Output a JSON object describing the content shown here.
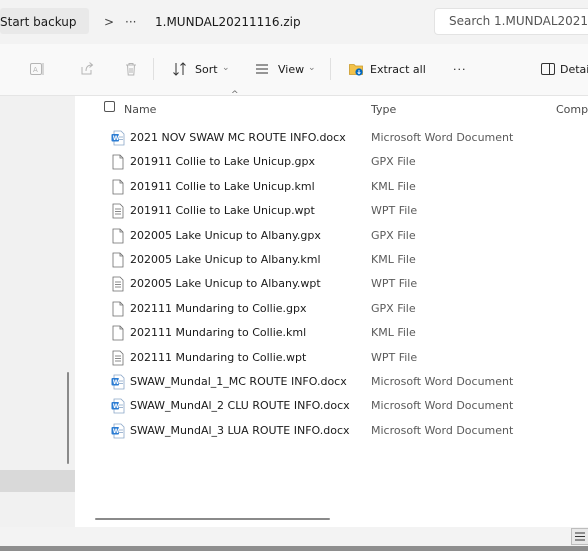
{
  "address_bar": {
    "breadcrumb_start": "Start backup",
    "separator": ">",
    "overflow": "···",
    "current_folder": "1.MUNDAL20211116.zip",
    "search_placeholder": "Search 1.MUNDAL20211"
  },
  "command_bar": {
    "sort_label": "Sort",
    "view_label": "View",
    "extract_all_label": "Extract all",
    "more_label": "···",
    "details_label": "Detai"
  },
  "columns": {
    "name": "Name",
    "type": "Type",
    "compressed": "Comp"
  },
  "files": [
    {
      "name": "2021 NOV SWAW MC ROUTE INFO.docx",
      "type": "Microsoft Word Document",
      "icon": "word-doc-icon"
    },
    {
      "name": "201911 Collie to Lake Unicup.gpx",
      "type": "GPX File",
      "icon": "file-icon"
    },
    {
      "name": "201911 Collie to Lake Unicup.kml",
      "type": "KML File",
      "icon": "file-icon"
    },
    {
      "name": "201911 Collie to Lake Unicup.wpt",
      "type": "WPT File",
      "icon": "text-file-icon"
    },
    {
      "name": "202005 Lake Unicup to Albany.gpx",
      "type": "GPX File",
      "icon": "file-icon"
    },
    {
      "name": "202005 Lake Unicup to Albany.kml",
      "type": "KML File",
      "icon": "file-icon"
    },
    {
      "name": "202005 Lake Unicup to Albany.wpt",
      "type": "WPT File",
      "icon": "text-file-icon"
    },
    {
      "name": "202111 Mundaring to Collie.gpx",
      "type": "GPX File",
      "icon": "file-icon"
    },
    {
      "name": "202111 Mundaring to Collie.kml",
      "type": "KML File",
      "icon": "file-icon"
    },
    {
      "name": "202111 Mundaring to Collie.wpt",
      "type": "WPT File",
      "icon": "text-file-icon"
    },
    {
      "name": "SWAW_Mundal_1_MC ROUTE INFO.docx",
      "type": "Microsoft Word Document",
      "icon": "word-doc-icon"
    },
    {
      "name": "SWAW_MundAl_2 CLU ROUTE INFO.docx",
      "type": "Microsoft Word Document",
      "icon": "word-doc-icon"
    },
    {
      "name": "SWAW_MundAl_3 LUA ROUTE INFO.docx",
      "type": "Microsoft Word Document",
      "icon": "word-doc-icon"
    }
  ],
  "colors": {
    "accent": "#0067c0",
    "word_blue": "#2b7cd3",
    "address_bg": "#f3f3f3",
    "nav_bg": "#f1f1f1"
  }
}
